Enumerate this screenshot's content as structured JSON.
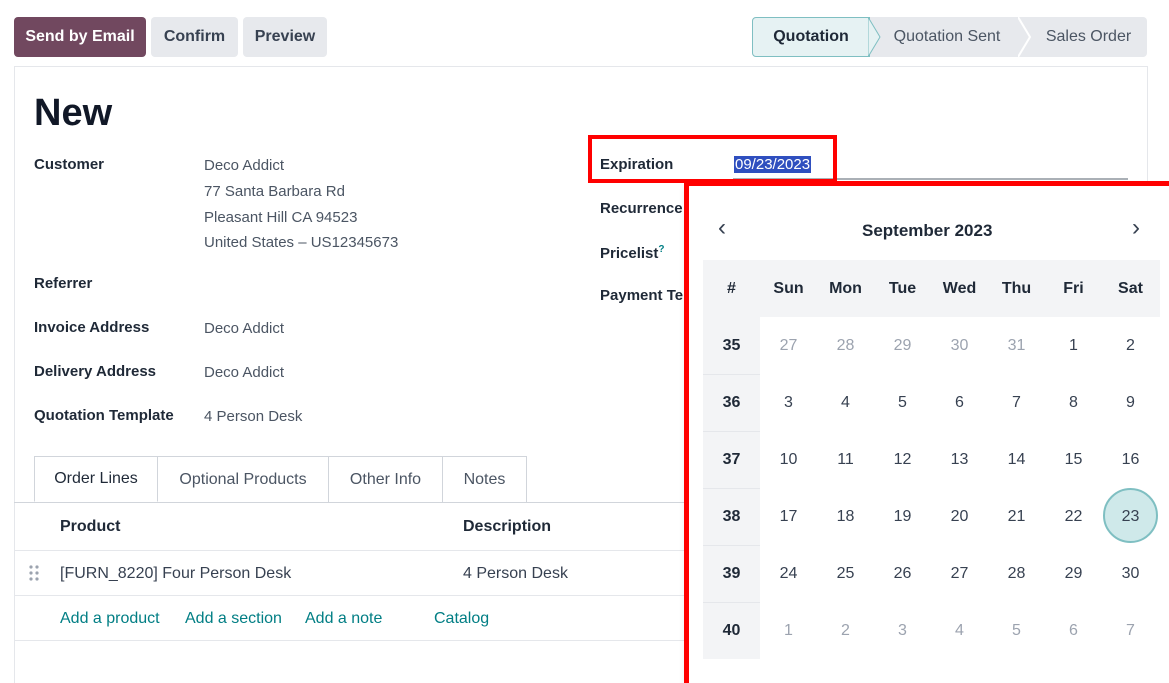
{
  "toolbar": {
    "send_email": "Send by Email",
    "confirm": "Confirm",
    "preview": "Preview"
  },
  "status_stages": [
    "Quotation",
    "Quotation Sent",
    "Sales Order"
  ],
  "form": {
    "title": "New",
    "customer_label": "Customer",
    "customer_name": "Deco Addict",
    "customer_addr1": "77 Santa Barbara Rd",
    "customer_addr2": "Pleasant Hill CA 94523",
    "customer_addr3": "United States – US12345673",
    "referrer_label": "Referrer",
    "invoice_label": "Invoice Address",
    "invoice_value": "Deco Addict",
    "delivery_label": "Delivery Address",
    "delivery_value": "Deco Addict",
    "template_label": "Quotation Template",
    "template_value": "4 Person Desk",
    "expiration_label": "Expiration",
    "expiration_value": "09/23/2023",
    "recurrence_label": "Recurrence",
    "pricelist_label": "Pricelist",
    "pricelist_help": "?",
    "payment_label": "Payment Te"
  },
  "tabs": [
    "Order Lines",
    "Optional Products",
    "Other Info",
    "Notes"
  ],
  "order_table": {
    "col_product": "Product",
    "col_description": "Description",
    "rows": [
      {
        "product": "[FURN_8220] Four Person Desk",
        "description": "4 Person Desk"
      }
    ],
    "handle_icon": "drag-handle-icon",
    "add_product": "Add a product",
    "add_section": "Add a section",
    "add_note": "Add a note",
    "catalog": "Catalog"
  },
  "calendar": {
    "month_label": "September 2023",
    "prev": "‹",
    "next": "›",
    "headers": [
      "#",
      "Sun",
      "Mon",
      "Tue",
      "Wed",
      "Thu",
      "Fri",
      "Sat"
    ],
    "weeks": [
      {
        "wk": "35",
        "days": [
          "27",
          "28",
          "29",
          "30",
          "31",
          "1",
          "2"
        ],
        "muted": [
          1,
          1,
          1,
          1,
          1,
          0,
          0
        ]
      },
      {
        "wk": "36",
        "days": [
          "3",
          "4",
          "5",
          "6",
          "7",
          "8",
          "9"
        ],
        "muted": [
          0,
          0,
          0,
          0,
          0,
          0,
          0
        ]
      },
      {
        "wk": "37",
        "days": [
          "10",
          "11",
          "12",
          "13",
          "14",
          "15",
          "16"
        ],
        "muted": [
          0,
          0,
          0,
          0,
          0,
          0,
          0
        ]
      },
      {
        "wk": "38",
        "days": [
          "17",
          "18",
          "19",
          "20",
          "21",
          "22",
          "23"
        ],
        "muted": [
          0,
          0,
          0,
          0,
          0,
          0,
          0
        ]
      },
      {
        "wk": "39",
        "days": [
          "24",
          "25",
          "26",
          "27",
          "28",
          "29",
          "30"
        ],
        "muted": [
          0,
          0,
          0,
          0,
          0,
          0,
          0
        ]
      },
      {
        "wk": "40",
        "days": [
          "1",
          "2",
          "3",
          "4",
          "5",
          "6",
          "7"
        ],
        "muted": [
          1,
          1,
          1,
          1,
          1,
          1,
          1
        ]
      }
    ],
    "selected_day": "23"
  },
  "colors": {
    "primary": "#71485f",
    "accent": "#017e84",
    "highlight": "#ff0000",
    "selection": "#2f4fbf"
  }
}
